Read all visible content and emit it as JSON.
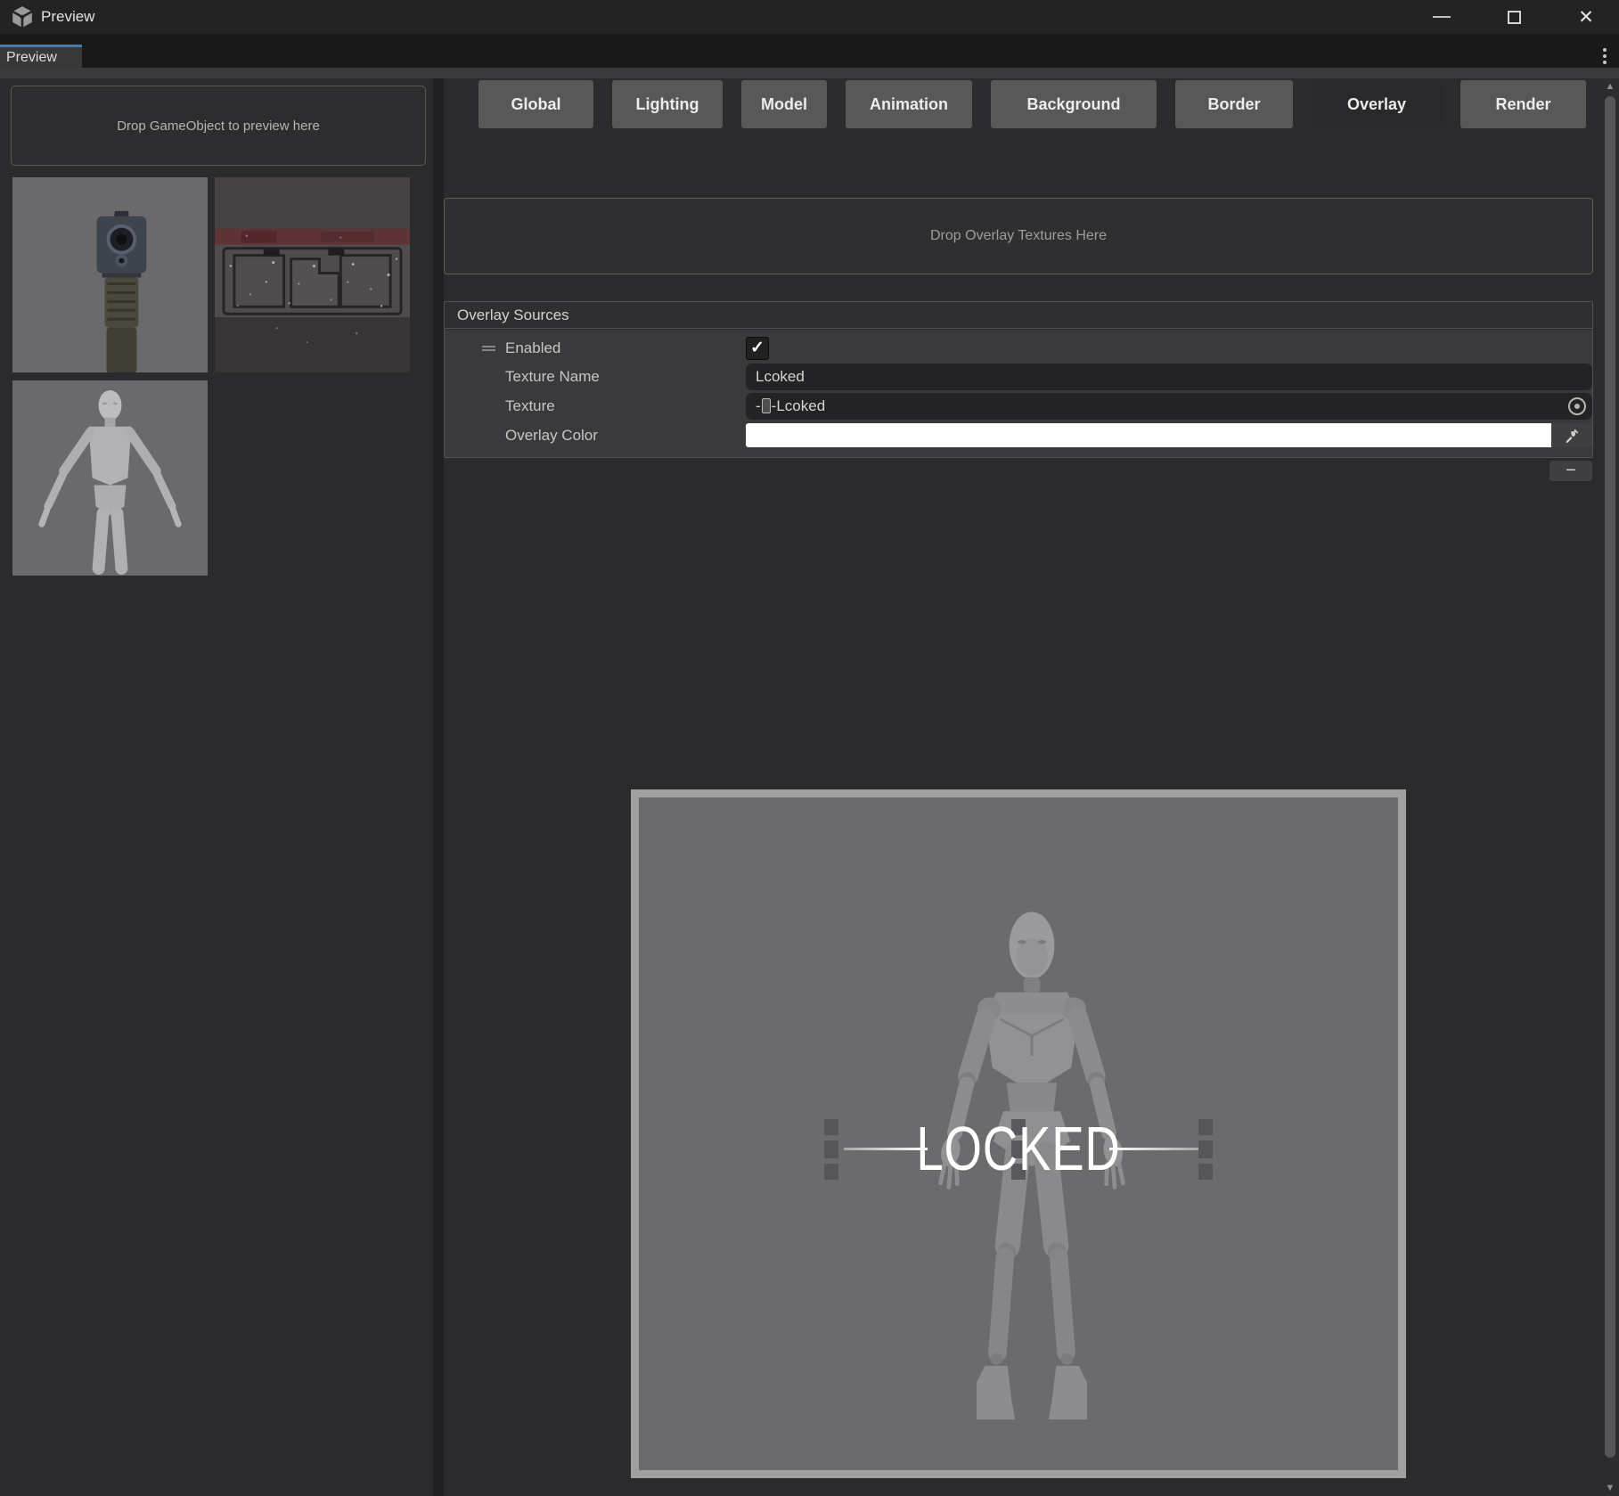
{
  "window": {
    "title": "Preview"
  },
  "icons": {
    "close": "✕",
    "kebab": "vertical-dots",
    "check": "✓",
    "minus": "−",
    "scroll_up": "▲",
    "scroll_down": "▼"
  },
  "tab": {
    "label": "Preview"
  },
  "left_panel": {
    "drop_hint": "Drop GameObject to preview here",
    "thumbnails": [
      {
        "name": "pistol-front-view"
      },
      {
        "name": "metal-crate-texture"
      },
      {
        "name": "mannequin-a-pose"
      }
    ]
  },
  "toolbar": {
    "buttons": [
      "Global",
      "Lighting",
      "Model",
      "Animation",
      "Background",
      "Border",
      "Overlay",
      "Render"
    ],
    "active": "Overlay"
  },
  "overlay_tab": {
    "drop_hint": "Drop Overlay Textures Here",
    "section_title": "Overlay Sources",
    "enabled_label": "Enabled",
    "enabled_checked": true,
    "texture_name_label": "Texture Name",
    "texture_name_value": "Lcoked",
    "texture_label": "Texture",
    "texture_value_prefix": "-",
    "texture_value_suffix": "-Lcoked",
    "overlay_color_label": "Overlay Color",
    "overlay_color_value": "#ffffff"
  },
  "preview": {
    "overlay_text": "LOCKED"
  },
  "colors": {
    "accent_blue": "#4b7ba6",
    "titlebar_bg": "#232323",
    "panel_bg": "#2b2b2d",
    "button_bg": "#585858",
    "button_active_bg": "#29292c",
    "field_bg": "#232325",
    "preview_frame": "#a0a0a0",
    "preview_bg": "#6b6b6d",
    "mannequin": "#8e8e91",
    "overlay_white": "#ffffff"
  }
}
